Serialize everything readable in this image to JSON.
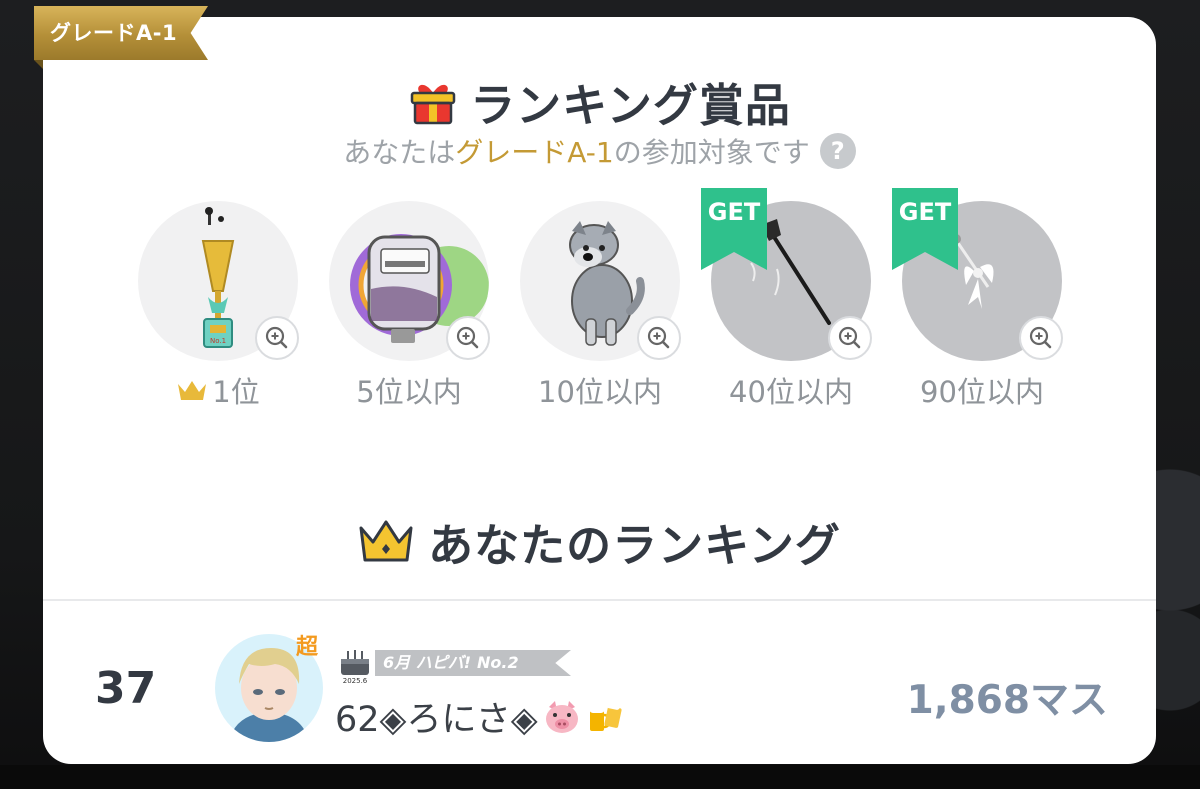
{
  "grade_badge": {
    "label": "グレードA-1"
  },
  "prizes_section": {
    "title": "ランキング賞品",
    "subtitle_prefix": "あなたは",
    "subtitle_highlight": "グレードA-1",
    "subtitle_suffix": "の参加対象です",
    "help_label": "?"
  },
  "prizes": [
    {
      "rank_label": "1位",
      "icon": "trophy-icon",
      "obtained": false,
      "crowned": true
    },
    {
      "rank_label": "5位以内",
      "icon": "bag-icon",
      "obtained": false,
      "crowned": false
    },
    {
      "rank_label": "10位以内",
      "icon": "dog-icon",
      "obtained": false,
      "crowned": false
    },
    {
      "rank_label": "40位以内",
      "icon": "staff-icon",
      "obtained": true,
      "crowned": false
    },
    {
      "rank_label": "90位以内",
      "icon": "ribbon-wand-icon",
      "obtained": true,
      "crowned": false
    }
  ],
  "get_tag_label": "GET",
  "my_ranking": {
    "title": "あなたのランキング",
    "rank": "37",
    "super_badge": "超",
    "event_badge": {
      "year": "2025.6",
      "text": "6月 ハピバ!",
      "no": "No.2"
    },
    "username": "62◈ろにさ◈",
    "score": "1,868マス"
  },
  "colors": {
    "gold": "#c49a35",
    "get_green": "#2fc18c",
    "title_text": "#333942",
    "score_text": "#7f8fa4"
  }
}
